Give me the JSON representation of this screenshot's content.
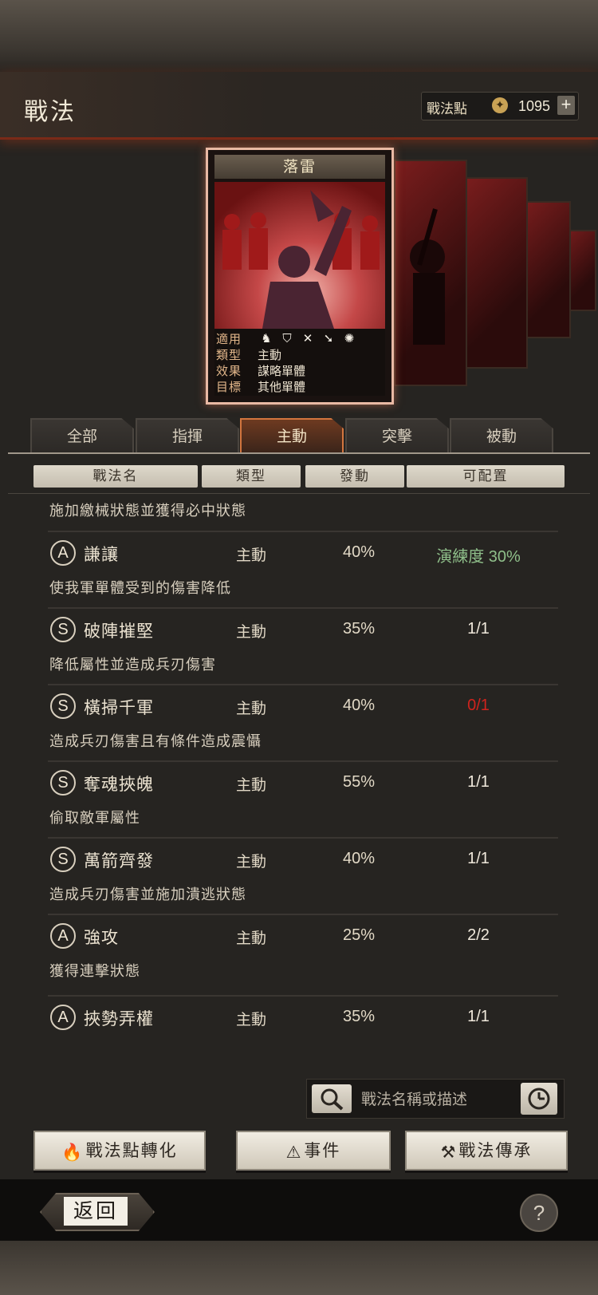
{
  "header": {
    "title": "戰法",
    "points_label": "戰法點",
    "points_value": "1095",
    "plus_label": "+"
  },
  "card": {
    "name": "落雷",
    "rows": [
      {
        "key": "適用",
        "value": ""
      },
      {
        "key": "類型",
        "value": "主動"
      },
      {
        "key": "效果",
        "value": "謀略單體"
      },
      {
        "key": "目標",
        "value": "其他單體"
      }
    ],
    "weapon_icons": [
      "cavalry-icon",
      "shield-icon",
      "bow-icon",
      "spear-icon",
      "chariot-icon"
    ]
  },
  "tabs": [
    {
      "label": "全部",
      "active": false
    },
    {
      "label": "指揮",
      "active": false
    },
    {
      "label": "主動",
      "active": true
    },
    {
      "label": "突擊",
      "active": false
    },
    {
      "label": "被動",
      "active": false
    }
  ],
  "columns": [
    "戰法名",
    "類型",
    "發動",
    "可配置"
  ],
  "partial_desc": "施加繳械狀態並獲得必中狀態",
  "skills": [
    {
      "grade": "A",
      "name": "謙讓",
      "type": "主動",
      "rate": "40%",
      "config": "演練度 30%",
      "config_color": "#8fbf8a",
      "desc": "使我軍單體受到的傷害降低"
    },
    {
      "grade": "S",
      "name": "破陣摧堅",
      "type": "主動",
      "rate": "35%",
      "config": "1/1",
      "config_color": "#f0e9dc",
      "desc": "降低屬性並造成兵刃傷害"
    },
    {
      "grade": "S",
      "name": "橫掃千軍",
      "type": "主動",
      "rate": "40%",
      "config": "0/1",
      "config_color": "#d0231d",
      "desc": "造成兵刃傷害且有條件造成震懾"
    },
    {
      "grade": "S",
      "name": "奪魂挾魄",
      "type": "主動",
      "rate": "55%",
      "config": "1/1",
      "config_color": "#f0e9dc",
      "desc": "偷取敵軍屬性"
    },
    {
      "grade": "S",
      "name": "萬箭齊發",
      "type": "主動",
      "rate": "40%",
      "config": "1/1",
      "config_color": "#f0e9dc",
      "desc": "造成兵刃傷害並施加潰逃狀態"
    },
    {
      "grade": "A",
      "name": "強攻",
      "type": "主動",
      "rate": "25%",
      "config": "2/2",
      "config_color": "#f0e9dc",
      "desc": "獲得連擊狀態"
    },
    {
      "grade": "A",
      "name": "挾勢弄權",
      "type": "主動",
      "rate": "35%",
      "config": "1/1",
      "config_color": "#f0e9dc",
      "desc": ""
    }
  ],
  "search": {
    "placeholder": "戰法名稱或描述"
  },
  "actions": {
    "convert": "戰法點轉化",
    "events": "事件",
    "inherit": "戰法傳承"
  },
  "footer": {
    "back": "返回",
    "help": "?"
  }
}
